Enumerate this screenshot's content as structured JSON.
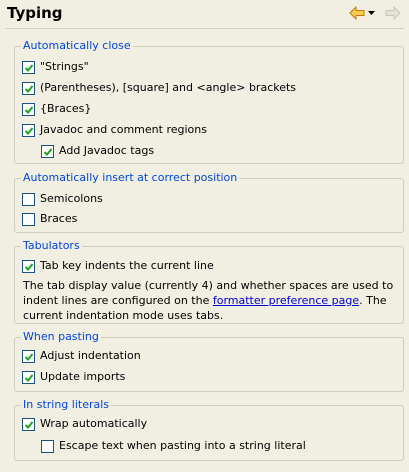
{
  "page": {
    "title": "Typing"
  },
  "nav": {
    "back_icon": "back-arrow-icon",
    "menu_icon": "dropdown-triangle-icon",
    "forward_icon": "forward-arrow-icon",
    "accent": "#e8a31c",
    "disabled": "#c9c6b5"
  },
  "groups": {
    "auto_close": {
      "title": "Automatically close",
      "items": [
        {
          "label": "\"Strings\"",
          "checked": true
        },
        {
          "label": "(Parentheses), [square] and <angle> brackets",
          "checked": true
        },
        {
          "label": "{Braces}",
          "checked": true
        },
        {
          "label": "Javadoc and comment regions",
          "checked": true
        },
        {
          "label": "Add Javadoc tags",
          "checked": true
        }
      ]
    },
    "auto_insert": {
      "title": "Automatically insert at correct position",
      "items": [
        {
          "label": "Semicolons",
          "checked": false
        },
        {
          "label": "Braces",
          "checked": false
        }
      ]
    },
    "tabulators": {
      "title": "Tabulators",
      "items": [
        {
          "label": "Tab key indents the current line",
          "checked": true
        }
      ],
      "desc_before": "The tab display value (currently 4) and whether spaces are used to indent lines are configured on the ",
      "desc_link": "formatter preference page",
      "desc_after": ". The current indentation mode uses tabs."
    },
    "pasting": {
      "title": "When pasting",
      "items": [
        {
          "label": "Adjust indentation",
          "checked": true
        },
        {
          "label": "Update imports",
          "checked": true
        }
      ]
    },
    "strings": {
      "title": "In string literals",
      "items": [
        {
          "label": "Wrap automatically",
          "checked": true
        },
        {
          "label": "Escape text when pasting into a string literal",
          "checked": false
        }
      ]
    }
  },
  "colors": {
    "group_title": "#0046d5",
    "check": "#21a121",
    "checkbox_border": "#1c5180",
    "background": "#f1efe2"
  }
}
